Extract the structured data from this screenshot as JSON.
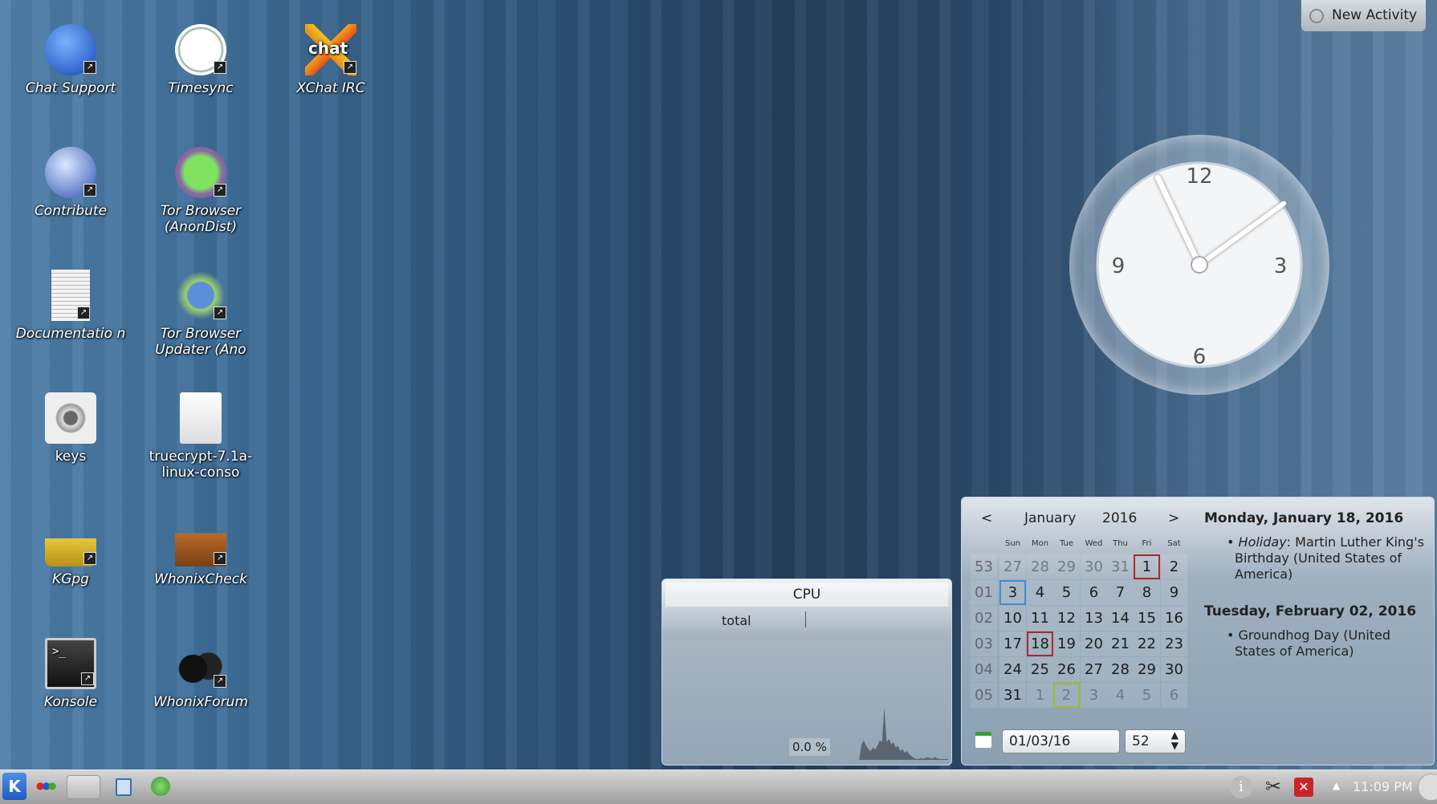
{
  "desktop_icons": [
    {
      "label": "Chat Support",
      "icon": "chat-support-icon"
    },
    {
      "label": "Timesync",
      "icon": "timesync-icon"
    },
    {
      "label": "XChat IRC",
      "icon": "xchat-icon"
    },
    {
      "label": "Contribute",
      "icon": "contribute-globe-icon"
    },
    {
      "label": "Tor Browser (AnonDist)",
      "icon": "tor-browser-icon"
    },
    {
      "label": "Documentatio n",
      "icon": "document-icon"
    },
    {
      "label": "Tor Browser Updater (Ano",
      "icon": "tor-updater-icon"
    },
    {
      "label": "keys",
      "icon": "keys-safe-icon"
    },
    {
      "label": "truecrypt-7.1a-linux-conso",
      "icon": "tgz-archive-icon"
    },
    {
      "label": "KGpg",
      "icon": "padlock-icon"
    },
    {
      "label": "WhonixCheck",
      "icon": "whonixcheck-box-icon"
    },
    {
      "label": "Konsole",
      "icon": "terminal-icon"
    },
    {
      "label": "WhonixForum",
      "icon": "forum-users-icon"
    }
  ],
  "xchat_logo_text": "chat",
  "new_activity": "New Activity",
  "clock": {
    "numerals": [
      "12",
      "3",
      "6",
      "9"
    ],
    "hour": 11,
    "minute": 9
  },
  "calendar": {
    "prev": "<",
    "next": ">",
    "month": "January",
    "year": "2016",
    "day_names": [
      "Sun",
      "Mon",
      "Tue",
      "Wed",
      "Thu",
      "Fri",
      "Sat"
    ],
    "weeks": [
      {
        "week": "53",
        "days": [
          "27",
          "28",
          "29",
          "30",
          "31",
          "1",
          "2"
        ],
        "current": [
          false,
          false,
          false,
          false,
          false,
          true,
          true
        ]
      },
      {
        "week": "01",
        "days": [
          "3",
          "4",
          "5",
          "6",
          "7",
          "8",
          "9"
        ],
        "current": [
          true,
          true,
          true,
          true,
          true,
          true,
          true
        ]
      },
      {
        "week": "02",
        "days": [
          "10",
          "11",
          "12",
          "13",
          "14",
          "15",
          "16"
        ],
        "current": [
          true,
          true,
          true,
          true,
          true,
          true,
          true
        ]
      },
      {
        "week": "03",
        "days": [
          "17",
          "18",
          "19",
          "20",
          "21",
          "22",
          "23"
        ],
        "current": [
          true,
          true,
          true,
          true,
          true,
          true,
          true
        ]
      },
      {
        "week": "04",
        "days": [
          "24",
          "25",
          "26",
          "27",
          "28",
          "29",
          "30"
        ],
        "current": [
          true,
          true,
          true,
          true,
          true,
          true,
          true
        ]
      },
      {
        "week": "05",
        "days": [
          "31",
          "1",
          "2",
          "3",
          "4",
          "5",
          "6"
        ],
        "current": [
          true,
          false,
          false,
          false,
          false,
          false,
          false
        ]
      }
    ],
    "date_input": "01/03/16",
    "week_spin": "52",
    "highlight_colors": {
      "today": "#b3262a",
      "selected": "#3d8fdc",
      "holiday": "#9cbf2a"
    }
  },
  "events": [
    {
      "date": "Monday, January 18, 2016",
      "items": [
        {
          "type": "Holiday",
          "text": ": Martin Luther King's Birthday (United States of America)"
        }
      ]
    },
    {
      "date": "Tuesday, February 02, 2016",
      "items": [
        {
          "type": "",
          "text": "Groundhog Day (United States of America)"
        }
      ]
    }
  ],
  "cpu": {
    "title": "CPU",
    "label": "total",
    "value": "0.0 %",
    "history": [
      0,
      0,
      0,
      0,
      0,
      18,
      22,
      16,
      12,
      10,
      14,
      12,
      16,
      22,
      20,
      60,
      20,
      24,
      18,
      20,
      14,
      16,
      10,
      12,
      8,
      10,
      6,
      4,
      2,
      1,
      1,
      2,
      1,
      2,
      3,
      2,
      1,
      3,
      2,
      1,
      1,
      1,
      1,
      1
    ]
  },
  "taskbar": {
    "clock": "11:09 PM"
  }
}
